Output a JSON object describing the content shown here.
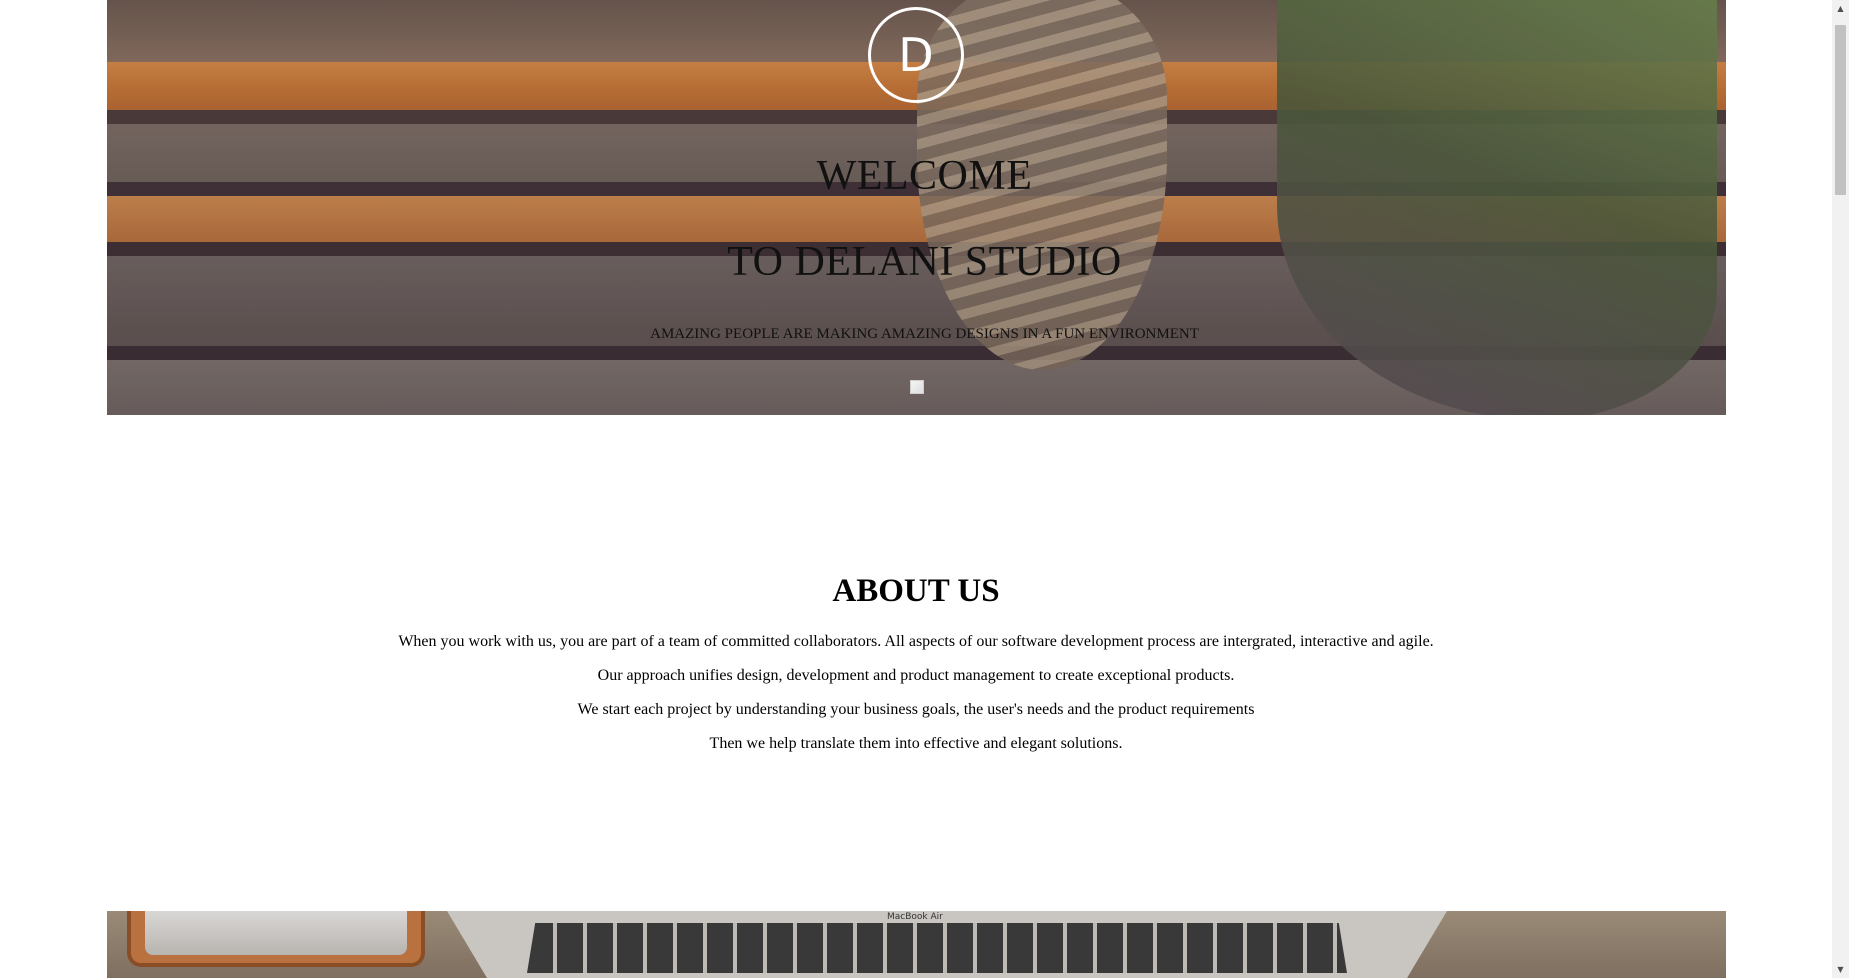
{
  "hero": {
    "logo_letter": "D",
    "title_line1": "WELCOME",
    "title_line2": "TO DELANI STUDIO",
    "subtitle": "AMAZING PEOPLE ARE MAKING AMAZING DESIGNS IN A FUN ENVIRONMENT"
  },
  "about": {
    "title": "ABOUT US",
    "paragraphs": [
      "When you work with us, you are part of a team of committed collaborators. All aspects of our software development process are intergrated, interactive and agile.",
      "Our approach unifies design, development and product management to create exceptional products.",
      "We start each project by understanding your business goals, the user's needs and the product requirements",
      "Then we help translate them into effective and elegant solutions."
    ]
  },
  "bottom_banner": {
    "laptop_brand": "MacBook Air"
  },
  "scrollbar": {
    "up_icon": "▲",
    "down_icon": "▼"
  }
}
